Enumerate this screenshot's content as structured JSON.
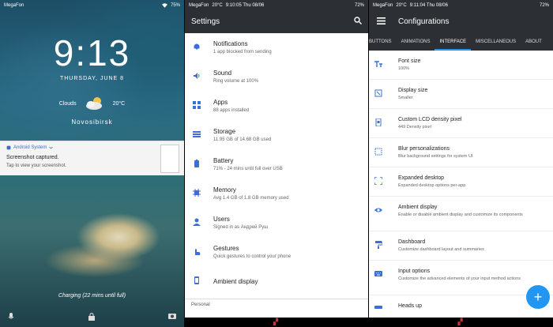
{
  "panel1": {
    "status": {
      "carrier": "MegaFon",
      "battery": "75%"
    },
    "clock": "9:13",
    "date": "THURSDAY, JUNE 8",
    "weather": {
      "label": "Clouds",
      "temp": "20°C"
    },
    "city": "Novosibirsk",
    "notification": {
      "app": "Android System",
      "title": "Screenshot captured.",
      "body": "Tap to view your screenshot."
    },
    "charging": "Charging (22 mins until full)"
  },
  "panel2": {
    "status": {
      "carrier": "MegaFon",
      "temp": "20°C",
      "time": "9:10:05 Thu 08/06",
      "battery": "72%"
    },
    "title": "Settings",
    "items": [
      {
        "title": "Notifications",
        "subtitle": "1 app blocked from sending",
        "icon": "bell-icon"
      },
      {
        "title": "Sound",
        "subtitle": "Ring volume at 100%",
        "icon": "volume-icon"
      },
      {
        "title": "Apps",
        "subtitle": "88 apps installed",
        "icon": "apps-icon"
      },
      {
        "title": "Storage",
        "subtitle": "11.95 GB of 14.68 GB used",
        "icon": "storage-icon"
      },
      {
        "title": "Battery",
        "subtitle": "71% - 24 mins until full over USB",
        "icon": "battery-icon"
      },
      {
        "title": "Memory",
        "subtitle": "Avg 1.4 GB of 1.8 GB memory used",
        "icon": "memory-icon"
      },
      {
        "title": "Users",
        "subtitle": "Signed in as Андрей Руш",
        "icon": "person-icon"
      },
      {
        "title": "Gestures",
        "subtitle": "Quick gestures to control your phone",
        "icon": "gesture-icon"
      },
      {
        "title": "Ambient display",
        "subtitle": "",
        "icon": "ambient-icon"
      }
    ],
    "section": "Personal"
  },
  "panel3": {
    "status": {
      "carrier": "MegaFon",
      "temp": "20°C",
      "time": "9:11:04 Thu 08/06",
      "battery": "72%"
    },
    "title": "Configurations",
    "tabs": [
      "BUTTONS",
      "ANIMATIONS",
      "INTERFACE",
      "MISCELLANEOUS",
      "ABOUT"
    ],
    "active_tab": "INTERFACE",
    "items": [
      {
        "title": "Font size",
        "subtitle": "100%",
        "icon": "font-size-icon"
      },
      {
        "title": "Display size",
        "subtitle": "Smaller",
        "icon": "display-size-icon"
      },
      {
        "title": "Custom LCD density pixel",
        "subtitle": "449 Density pixel",
        "icon": "density-icon"
      },
      {
        "title": "Blur personalizations",
        "subtitle": "Blur background settings for system UI",
        "icon": "blur-icon"
      },
      {
        "title": "Expanded desktop",
        "subtitle": "Expanded desktop options per-app",
        "icon": "expand-icon"
      },
      {
        "title": "Ambient display",
        "subtitle": "Enable or disable ambient display and customize its components",
        "icon": "eye-icon"
      },
      {
        "title": "Dashboard",
        "subtitle": "Customize dashboard layout and summaries",
        "icon": "paint-roller-icon"
      },
      {
        "title": "Input options",
        "subtitle": "Customize the advanced elements of your input method actions",
        "icon": "keyboard-icon"
      },
      {
        "title": "Heads up",
        "subtitle": "",
        "icon": "heads-up-icon"
      }
    ],
    "fab": "+"
  }
}
